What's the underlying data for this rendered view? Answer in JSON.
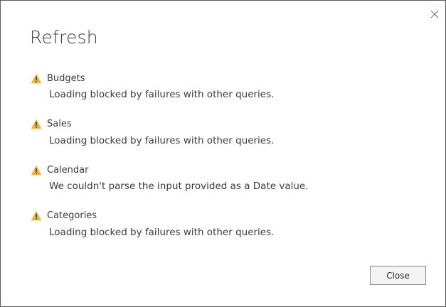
{
  "dialog": {
    "title": "Refresh",
    "close_label": "Close",
    "items": [
      {
        "name": "Budgets",
        "message": "Loading blocked by failures with other queries.",
        "icon": "warning-icon"
      },
      {
        "name": "Sales",
        "message": "Loading blocked by failures with other queries.",
        "icon": "warning-icon"
      },
      {
        "name": "Calendar",
        "message": "We couldn't parse the input provided as a Date value.",
        "icon": "warning-icon"
      },
      {
        "name": "Categories",
        "message": "Loading blocked by failures with other queries.",
        "icon": "warning-icon"
      }
    ]
  },
  "colors": {
    "warning_fill": "#f2b33d",
    "warning_mark": "#3a3a3a",
    "text": "#3c3c3c",
    "border": "#5a5a5a"
  }
}
